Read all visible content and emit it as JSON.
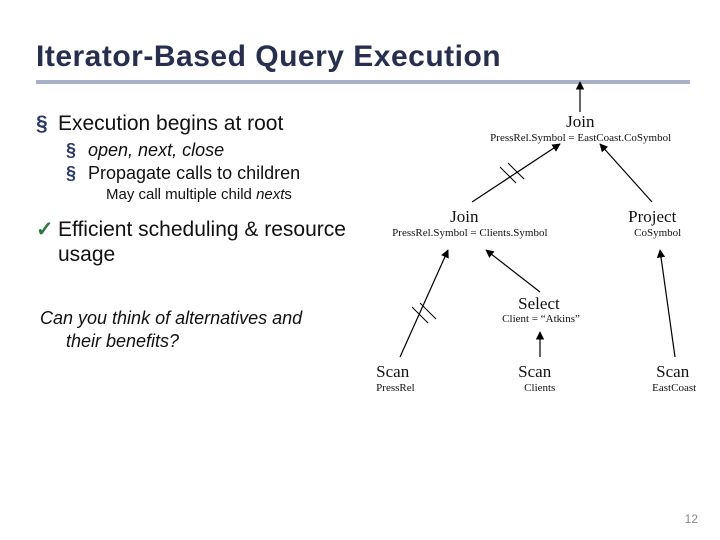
{
  "title": "Iterator-Based Query Execution",
  "bullets": {
    "root": "Execution begins at root",
    "open": "open, next, close",
    "prop": "Propagate calls to children",
    "may": "May call multiple child ",
    "may_i": "next",
    "may_s": "s",
    "eff": "Efficient scheduling & resource usage"
  },
  "question": {
    "l1": "Can you think of alternatives and",
    "l2": "their benefits?"
  },
  "tree": {
    "join_top": "Join",
    "cond_top": "PressRel.Symbol = EastCoast.CoSymbol",
    "join_left": "Join",
    "cond_left": "PressRel.Symbol = Clients.Symbol",
    "project": "Project",
    "project_sub": "CoSymbol",
    "select": "Select",
    "select_cond": "Client = “Atkins”",
    "scan1": "Scan",
    "scan1_sub": "PressRel",
    "scan2": "Scan",
    "scan2_sub": "Clients",
    "scan3": "Scan",
    "scan3_sub": "EastCoast"
  },
  "page": "12"
}
